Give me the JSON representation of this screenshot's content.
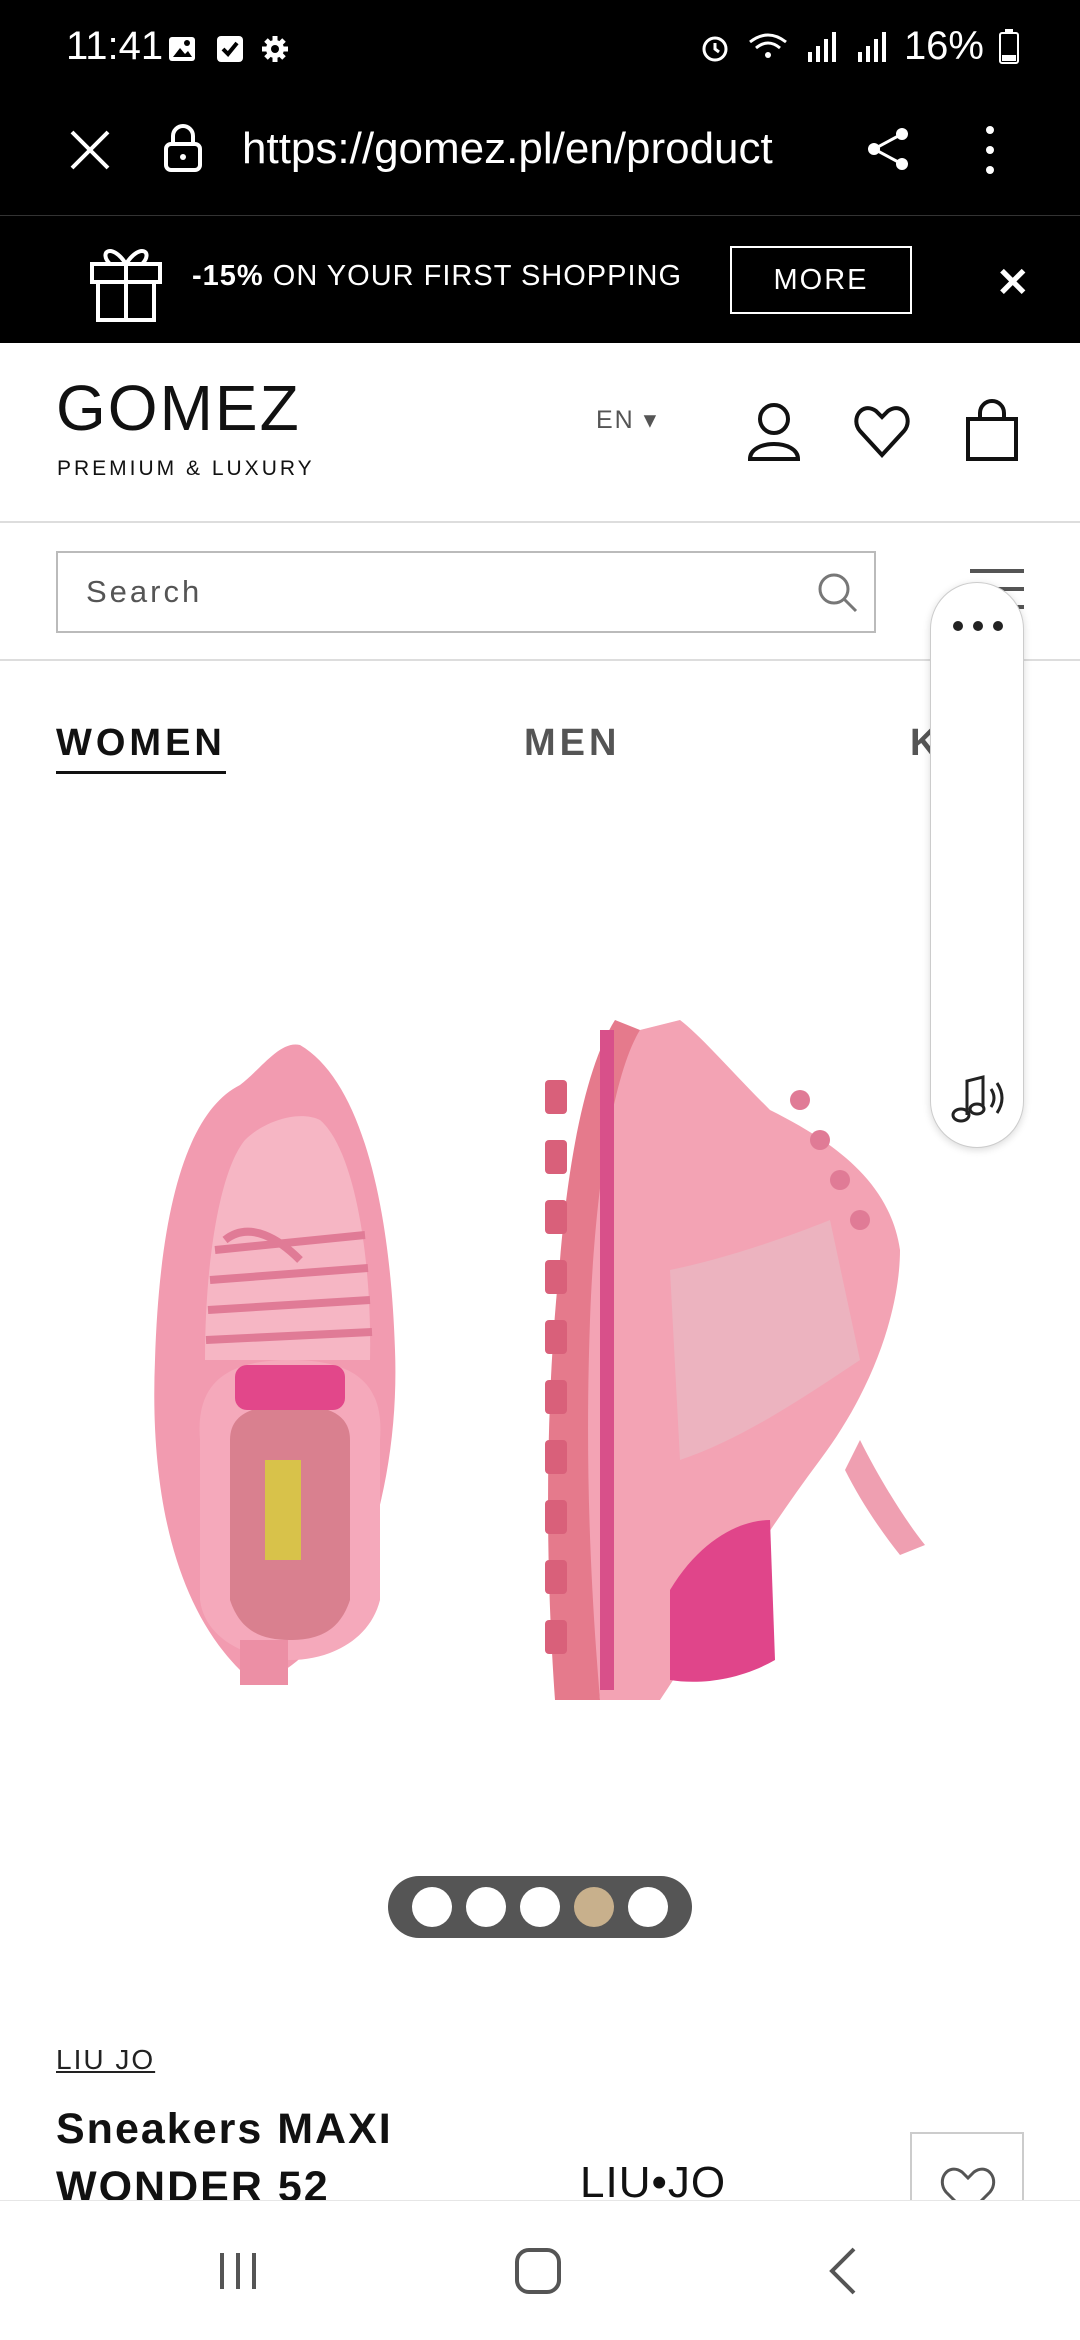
{
  "status_bar": {
    "time": "11:41",
    "battery": "16%"
  },
  "browser": {
    "url": "https://gomez.pl/en/product"
  },
  "promo": {
    "bold": "-15%",
    "text": " ON YOUR FIRST SHOPPING",
    "more_label": "MORE"
  },
  "header": {
    "logo": "GOMEZ",
    "logo_sub": "PREMIUM & LUXURY",
    "lang": "EN ▾"
  },
  "search": {
    "placeholder": "Search"
  },
  "tabs": [
    {
      "label": "WOMEN"
    },
    {
      "label": "MEN"
    },
    {
      "label": "K"
    }
  ],
  "carousel": {
    "count": 5,
    "active_index": 3
  },
  "product": {
    "brand": "LIU JO",
    "title": "Sneakers MAXI WONDER 52",
    "brand_logo": "LIU•JO"
  },
  "colors": {
    "accent": "#c8b08c",
    "shoe_pink": "#f29bb0",
    "shoe_magenta": "#e2478a"
  }
}
